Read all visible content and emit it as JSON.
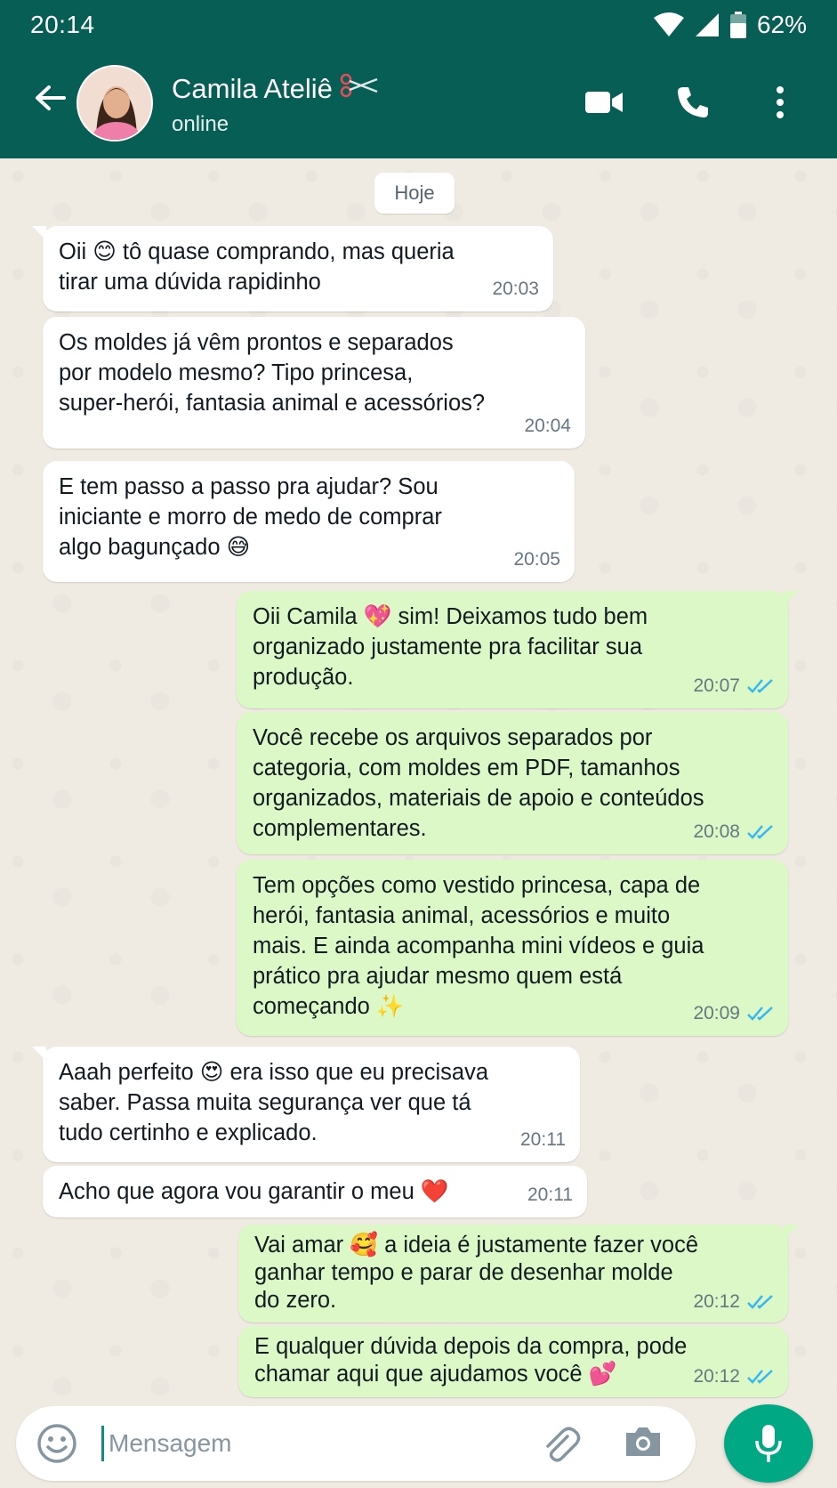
{
  "status_bar": {
    "time": "20:14",
    "battery": "62%"
  },
  "header": {
    "contact_name": "Camila Ateliê",
    "contact_status": "online"
  },
  "chat": {
    "date_label": "Hoje",
    "messages": [
      {
        "direction": "in",
        "text": "Oii 😊 tô quase comprando, mas queria\ntirar uma dúvida rapidinho",
        "time": "20:03"
      },
      {
        "direction": "in",
        "text": "Os moldes já vêm prontos e separados\npor modelo mesmo? Tipo princesa,\nsuper-herói, fantasia animal e acessórios?",
        "time": "20:04"
      },
      {
        "direction": "in",
        "text": "E tem passo a passo pra ajudar? Sou\niniciante e morro de medo de comprar\nalgo bagunçado 😅",
        "time": "20:05"
      },
      {
        "direction": "out",
        "text": "Oii Camila 💖 sim! Deixamos tudo bem\norganizado justamente pra facilitar sua\nprodução.",
        "time": "20:07",
        "read": true
      },
      {
        "direction": "out",
        "text": "Você recebe os arquivos separados por\ncategoria, com moldes em PDF, tamanhos\norganizados, materiais de apoio e conteúdos\ncomplementares.",
        "time": "20:08",
        "read": true
      },
      {
        "direction": "out",
        "text": "Tem opções como vestido princesa, capa de\nherói, fantasia animal, acessórios e muito\nmais. E ainda acompanha mini vídeos e guia\nprático pra ajudar mesmo quem está\ncomeçando ✨",
        "time": "20:09",
        "read": true
      },
      {
        "direction": "in",
        "text": "Aaah perfeito 😍 era isso que eu precisava\nsaber. Passa muita segurança ver que tá\ntudo certinho e explicado.",
        "time": "20:11"
      },
      {
        "direction": "in",
        "text": "Acho que agora vou garantir o meu ❤️",
        "time": "20:11"
      },
      {
        "direction": "out",
        "text": "Vai amar 🥰 a ideia é justamente fazer você\nganhar tempo e parar de desenhar molde\ndo zero.",
        "time": "20:12",
        "read": true
      },
      {
        "direction": "out",
        "text": "E qualquer dúvida depois da compra, pode\nchamar aqui que ajudamos você 💕",
        "time": "20:12",
        "read": true
      }
    ]
  },
  "composer": {
    "placeholder": "Mensagem"
  },
  "colors": {
    "header": "#075e54",
    "outgoing_bubble": "#dcf8c6",
    "incoming_bubble": "#ffffff",
    "read_ticks": "#34b7f1",
    "mic_button": "#00a884"
  },
  "icons": [
    "back-arrow-icon",
    "scissors-icon",
    "video-call-icon",
    "phone-icon",
    "more-options-icon",
    "emoji-icon",
    "attach-icon",
    "camera-icon",
    "mic-icon",
    "read-receipt-icon",
    "wifi-icon",
    "signal-icon",
    "battery-icon"
  ]
}
